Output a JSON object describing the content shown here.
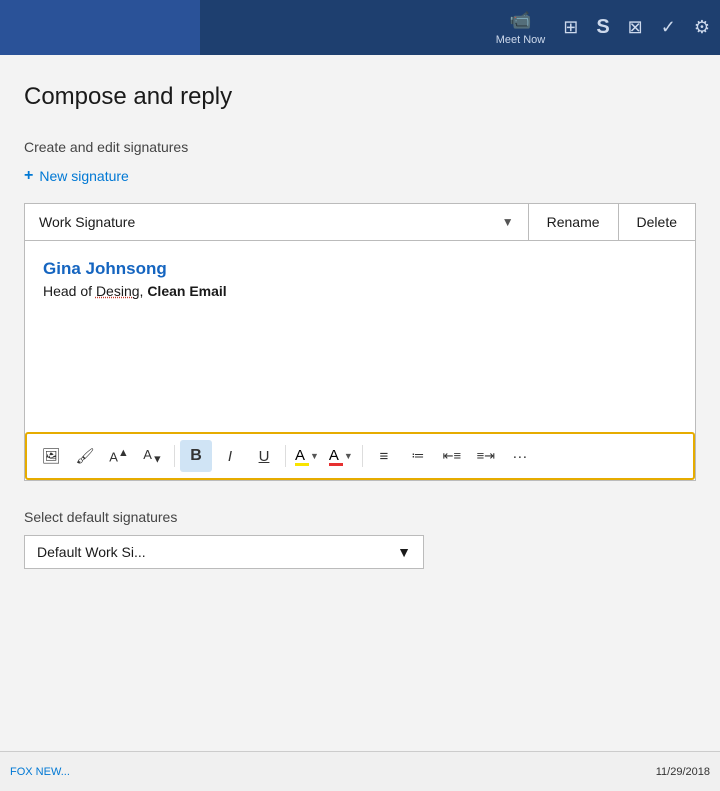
{
  "topbar": {
    "meet_now_label": "Meet Now",
    "icons": [
      "📹",
      "⊞",
      "S",
      "⊠",
      "✓",
      "⚙"
    ]
  },
  "header": {
    "title": "Compose and reply"
  },
  "signatures": {
    "section_label": "Create and edit signatures",
    "new_button_label": "New signature",
    "selected_signature": "Work Signature",
    "rename_label": "Rename",
    "delete_label": "Delete",
    "editor": {
      "author_name": "Gina Johnsong",
      "author_title_prefix": "Head of ",
      "author_title_word_underline": "Desing",
      "author_title_suffix": ", ",
      "author_company": "Clean Email"
    }
  },
  "toolbar": {
    "buttons": [
      {
        "name": "image-icon",
        "symbol": "🖼",
        "label": "Image"
      },
      {
        "name": "format-painter-icon",
        "symbol": "🖌",
        "label": "Format Painter"
      },
      {
        "name": "font-size-up-icon",
        "symbol": "Aᴬ",
        "label": "Increase font"
      },
      {
        "name": "font-size-down-icon",
        "symbol": "Aᵥ",
        "label": "Decrease font"
      },
      {
        "name": "bold-icon",
        "symbol": "B",
        "label": "Bold",
        "active": true
      },
      {
        "name": "italic-icon",
        "symbol": "I",
        "label": "Italic"
      },
      {
        "name": "underline-icon",
        "symbol": "U",
        "label": "Underline"
      },
      {
        "name": "highlight-icon",
        "symbol": "A",
        "label": "Highlight",
        "hasDropdown": true,
        "color": "#f9e400"
      },
      {
        "name": "font-color-icon",
        "symbol": "A",
        "label": "Font color",
        "hasDropdown": true,
        "color": "#e63030"
      },
      {
        "name": "align-justify-icon",
        "symbol": "≡",
        "label": "Justify"
      },
      {
        "name": "bullets-icon",
        "symbol": "≔",
        "label": "Bullets"
      },
      {
        "name": "decrease-indent-icon",
        "symbol": "⇤≡",
        "label": "Decrease indent"
      },
      {
        "name": "increase-indent-icon",
        "symbol": "≡⇥",
        "label": "Increase indent"
      },
      {
        "name": "more-icon",
        "symbol": "...",
        "label": "More"
      }
    ]
  },
  "default_signatures": {
    "label": "Select default signatures",
    "dropdown_value": "Default Work Si..."
  },
  "taskbar": {
    "link_text": "FOX NEW...",
    "date": "11/29/2018"
  }
}
